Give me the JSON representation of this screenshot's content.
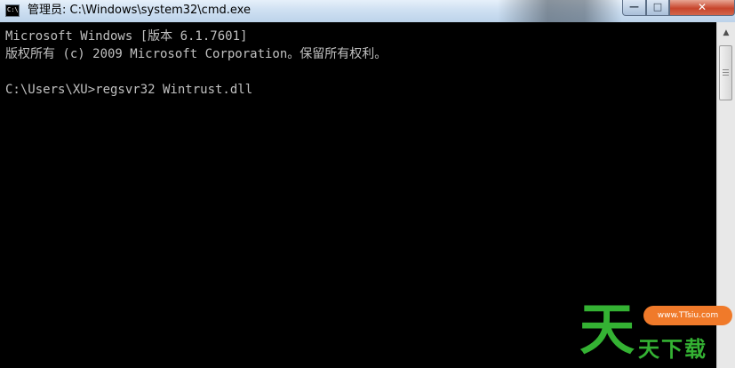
{
  "window": {
    "title": "管理员: C:\\Windows\\system32\\cmd.exe",
    "icon": "cmd-icon",
    "icon_text": "C:\\",
    "controls": {
      "minimize": "—",
      "maximize": "□",
      "close": "✕"
    }
  },
  "console": {
    "lines": [
      "Microsoft Windows [版本 6.1.7601]",
      "版权所有 (c) 2009 Microsoft Corporation。保留所有权利。",
      "",
      "C:\\Users\\XU>regsvr32 Wintrust.dll"
    ],
    "background": "#000000",
    "foreground": "#c0c0c0"
  },
  "scrollbar": {
    "up_arrow": "▲"
  },
  "watermark": {
    "big_char": "天",
    "url": "www.TTsiu.com",
    "text": "天下载"
  }
}
